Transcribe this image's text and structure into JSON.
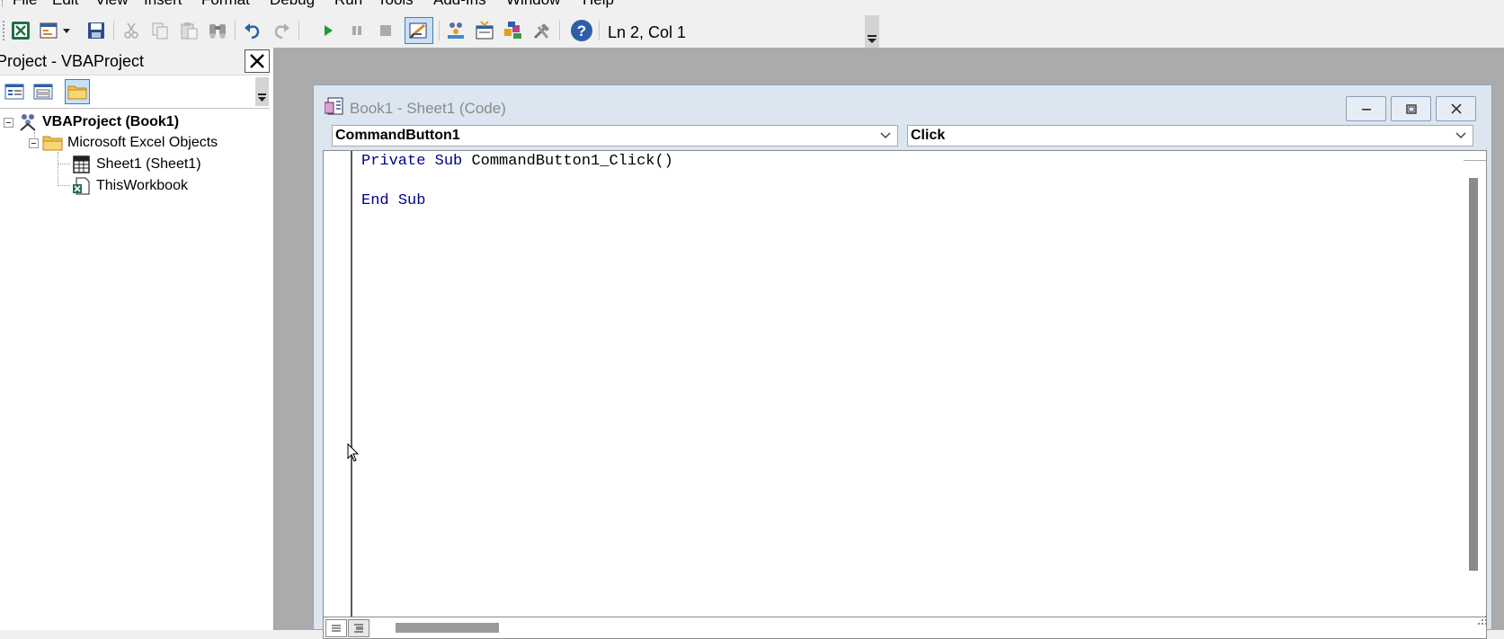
{
  "menu": {
    "items": [
      "File",
      "Edit",
      "View",
      "Insert",
      "Format",
      "Debug",
      "Run",
      "Tools",
      "Add-Ins",
      "Window",
      "Help"
    ]
  },
  "toolbar": {
    "buttons": [
      "view-excel-icon",
      "insert-userform-icon",
      "save-icon",
      "cut-icon",
      "copy-icon",
      "paste-icon",
      "find-icon",
      "undo-icon",
      "redo-icon",
      "run-icon",
      "break-icon",
      "reset-icon",
      "design-mode-icon",
      "project-explorer-icon",
      "properties-window-icon",
      "object-browser-icon",
      "toolbox-icon",
      "help-icon"
    ],
    "position_status": "Ln 2, Col 1"
  },
  "project_explorer": {
    "title": "Project - VBAProject",
    "tree": {
      "root": "VBAProject (Book1)",
      "folder": "Microsoft Excel Objects",
      "items": [
        "Sheet1 (Sheet1)",
        "ThisWorkbook"
      ]
    }
  },
  "code_window": {
    "title": "Book1 - Sheet1 (Code)",
    "object_combo": "CommandButton1",
    "procedure_combo": "Click",
    "code": {
      "line1": {
        "keyword1": "Private",
        "keyword2": "Sub",
        "rest": "CommandButton1_Click()"
      },
      "line2": {
        "keyword1": "End",
        "keyword2": "Sub"
      }
    }
  },
  "colors": {
    "keyword": "#00008b",
    "mdi_background": "#ababab",
    "code_window_frame": "#dbe6f1",
    "toolbar_bg": "#f0f0f0"
  }
}
